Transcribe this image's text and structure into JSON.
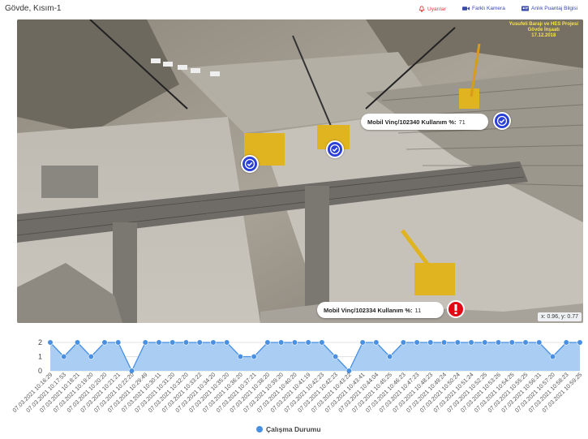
{
  "header": {
    "title": "Gövde, Kısım-1",
    "alerts_label": "Uyarılar",
    "camera_label": "Farklı Kamera",
    "attendance_label": "Anlık Puantaj Bilgisi"
  },
  "camera": {
    "overlay_text_line1": "Yusufeli Barajı ve HES Projesi",
    "overlay_text_line2": "Gövde İnşaatı",
    "overlay_text_line3": "17.12.2018",
    "coordinates": "x: 0.96, y: 0.77",
    "annotations": [
      {
        "label": "Mobil Vinç/102340 Kullanım %:",
        "value": "71",
        "status": "ok"
      },
      {
        "label": "Mobil Vinç/102334 Kullanım %:",
        "value": "11",
        "status": "alert"
      }
    ]
  },
  "chart_data": {
    "type": "area",
    "series": [
      {
        "name": "Çalışma Durumu",
        "values": [
          2,
          1,
          2,
          1,
          2,
          2,
          0,
          2,
          2,
          2,
          2,
          2,
          2,
          2,
          1,
          1,
          2,
          2,
          2,
          2,
          2,
          1,
          0,
          2,
          2,
          1,
          2,
          2,
          2,
          2,
          2,
          2,
          2,
          2,
          2,
          2,
          2,
          1,
          2,
          2
        ]
      }
    ],
    "categories": [
      "07.03.2021 10:16:29",
      "07.03.2021 10:17:53",
      "07.03.2021 10:18:21",
      "07.03.2021 10:19:20",
      "07.03.2021 10:20:20",
      "07.03.2021 10:21:21",
      "07.03.2021 10:22:20",
      "07.03.2021 10:29:49",
      "07.03.2021 10:30:11",
      "07.03.2021 10:31:20",
      "07.03.2021 10:32:20",
      "07.03.2021 10:33:22",
      "07.03.2021 10:34:20",
      "07.03.2021 10:35:20",
      "07.03.2021 10:36:20",
      "07.03.2021 10:37:21",
      "07.03.2021 10:38:20",
      "07.03.2021 10:39:20",
      "07.03.2021 10:40:20",
      "07.03.2021 10:41:19",
      "07.03.2021 10:42:23",
      "07.03.2021 10:42:23",
      "07.03.2021 10:43:22",
      "07.03.2021 10:43:41",
      "07.03.2021 10:44:04",
      "07.03.2021 10:45:25",
      "07.03.2021 10:46:23",
      "07.03.2021 10:47:23",
      "07.03.2021 10:48:23",
      "07.03.2021 10:49:24",
      "07.03.2021 10:50:24",
      "07.03.2021 10:51:24",
      "07.03.2021 10:52:25",
      "07.03.2021 10:53:26",
      "07.03.2021 10:54:25",
      "07.03.2021 10:55:25",
      "07.03.2021 10:56:31",
      "07.03.2021 10:57:20",
      "07.03.2021 10:58:23",
      "07.03.2021 10:59:25"
    ],
    "yticks": [
      0,
      1,
      2
    ],
    "ylim": [
      0,
      2
    ],
    "grid": true,
    "legend_position": "bottom-center",
    "color": "#4a90e2"
  }
}
